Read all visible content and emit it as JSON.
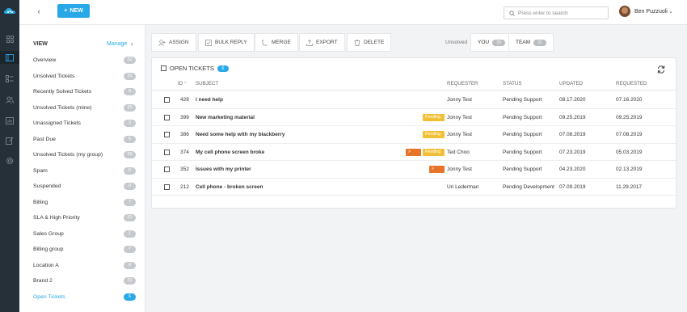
{
  "topbar": {
    "new_label": "NEW",
    "search_placeholder": "Press enter to search",
    "user_name": "Ben Puzzuoli"
  },
  "views": {
    "heading": "VIEW",
    "manage_label": "Manage",
    "items": [
      {
        "label": "Overview",
        "count": "62"
      },
      {
        "label": "Unsolved Tickets",
        "count": "31"
      },
      {
        "label": "Recently Solved Tickets",
        "count": "0"
      },
      {
        "label": "Unsolved Tickets (mine)",
        "count": "29"
      },
      {
        "label": "Unassigned Tickets",
        "count": "3"
      },
      {
        "label": "Past Due",
        "count": "6"
      },
      {
        "label": "Unsolved Tickets (my group)",
        "count": "29"
      },
      {
        "label": "Spam",
        "count": "0"
      },
      {
        "label": "Suspended",
        "count": "0"
      },
      {
        "label": "Billing",
        "count": "7"
      },
      {
        "label": "SLA & High Priority",
        "count": "31"
      },
      {
        "label": "Sales Group",
        "count": "1"
      },
      {
        "label": "Billing group",
        "count": "7"
      },
      {
        "label": "Location A",
        "count": "0"
      },
      {
        "label": "Brand 2",
        "count": "31"
      },
      {
        "label": "Open Tickets",
        "count": "6",
        "active": true
      }
    ]
  },
  "toolbar": {
    "assign": "ASSIGN",
    "bulk_reply": "BULK REPLY",
    "merge": "MERGE",
    "export": "EXPORT",
    "delete": "DELETE",
    "filter_label": "Unsolved",
    "you_label": "YOU",
    "you_count": "29",
    "team_label": "TEAM",
    "team_count": "31"
  },
  "tickets": {
    "title": "OPEN TICKETS",
    "count": "6",
    "columns": {
      "id": "ID",
      "subject": "SUBJECT",
      "requester": "REQUESTER",
      "status": "STATUS",
      "updated": "UPDATED",
      "requested": "REQUESTED"
    },
    "rows": [
      {
        "id": "428",
        "subject": "i need help",
        "tags": [],
        "requester": "Jonny Test",
        "status": "Pending Support",
        "updated": "08.17.2020",
        "requested": "07.16.2020"
      },
      {
        "id": "399",
        "subject": "New marketing material",
        "tags": [
          "Pending"
        ],
        "requester": "Jonny Test",
        "status": "Pending Support",
        "updated": "09.25.2019",
        "requested": "09.25.2019"
      },
      {
        "id": "386",
        "subject": "Need some help with my blackberry",
        "tags": [
          "Pending"
        ],
        "requester": "Jonny Test",
        "status": "Pending Support",
        "updated": "07.08.2019",
        "requested": "07.08.2019"
      },
      {
        "id": "374",
        "subject": "My cell phone screen broke",
        "tags": [
          "> SLA",
          "Pending"
        ],
        "requester": "Ted Choo",
        "status": "Pending Support",
        "updated": "07.23.2019",
        "requested": "05.03.2019"
      },
      {
        "id": "352",
        "subject": "Issues with my printer",
        "tags": [
          "> SLA"
        ],
        "requester": "Jonny Test",
        "status": "Pending Support",
        "updated": "04.23.2020",
        "requested": "02.13.2019"
      },
      {
        "id": "212",
        "subject": "Cell phone - broken screen",
        "tags": [],
        "requester": "Uri Lederman",
        "status": "Pending Development",
        "updated": "07.09.2019",
        "requested": "11.29.2017"
      }
    ]
  },
  "colors": {
    "accent": "#29a8e8",
    "rail": "#263039",
    "pending_tag": "#f2c037",
    "sla_tag": "#e8742a"
  }
}
